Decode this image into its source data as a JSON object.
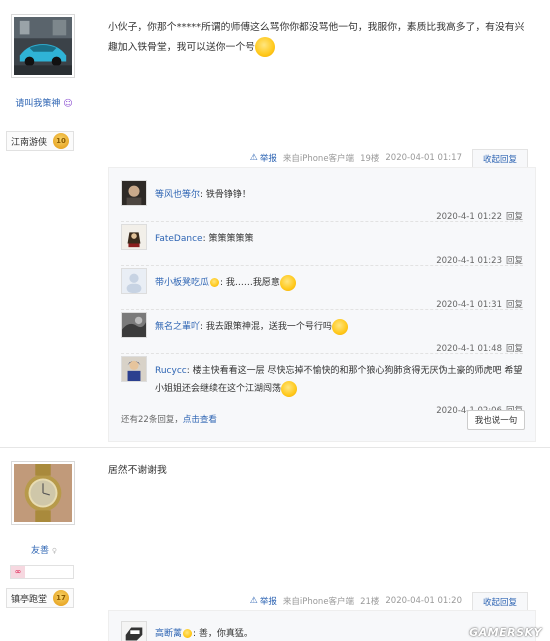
{
  "post1": {
    "username": "请叫我策神",
    "rank_title": "江南游侠",
    "rank_level": "10",
    "content": "小伙子，你那个*****所谓的师傅这么骂你你都没骂他一句，我服你，素质比我高多了，有没有兴趣加入铁骨堂，我可以送你一个号",
    "report_label": "举报",
    "source": "来自iPhone客户端",
    "floor": "19楼",
    "time": "2020-04-01 01:17",
    "reply_toggle": "收起回复",
    "replies": [
      {
        "name": "等风也等尔",
        "text": "铁骨铮铮！",
        "time": "2020-4-1 01:22",
        "reply": "回复"
      },
      {
        "name": "FateDance",
        "text": "策策策策策",
        "time": "2020-4-1 01:23",
        "reply": "回复"
      },
      {
        "name": "带小板凳吃瓜",
        "text": "我……我愿意",
        "time": "2020-4-1 01:31",
        "reply": "回复"
      },
      {
        "name": "無名之輩吖",
        "text": "我去跟策神混，送我一个号行吗",
        "time": "2020-4-1 01:48",
        "reply": "回复"
      },
      {
        "name": "Rucycc",
        "text": "楼主快看看这一层 尽快忘掉不愉快的和那个狼心狗肺贪得无厌伪土豪的师虎吧 希望小姐姐还会继续在这个江湖闯荡",
        "time": "2020-4-1 02:06",
        "reply": "回复"
      }
    ],
    "more_prefix": "还有22条回复，",
    "more_link": "点击查看",
    "say_button": "我也说一句"
  },
  "post2": {
    "username": "友善",
    "rank_title": "镇亭跑堂",
    "rank_level": "17",
    "content": "居然不谢谢我",
    "report_label": "举报",
    "source": "来自iPhone客户端",
    "floor": "21楼",
    "time": "2020-04-01 01:20",
    "reply_toggle": "收起回复",
    "first_reply": {
      "name": "高断蓠",
      "text": "善，你真猛。"
    }
  },
  "watermark": "GAMERSKY"
}
